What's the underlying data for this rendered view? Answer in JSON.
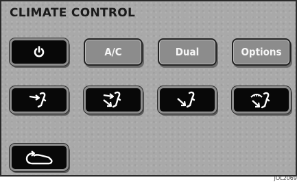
{
  "panel": {
    "title": "CLIMATE CONTROL"
  },
  "buttons_row1": {
    "power": {
      "icon": "power-icon"
    },
    "ac_label": "A/C",
    "dual_label": "Dual",
    "options_label": "Options"
  },
  "buttons_row2": [
    {
      "icon": "airflow-face-icon"
    },
    {
      "icon": "airflow-face-feet-icon"
    },
    {
      "icon": "airflow-feet-icon"
    },
    {
      "icon": "airflow-defrost-feet-icon"
    }
  ],
  "buttons_row3": {
    "recirculation": {
      "icon": "recirculation-icon"
    }
  },
  "footer": {
    "image_code": "JOL2069"
  },
  "colors": {
    "panel_background": "#a9a9a9",
    "active_button": "#080808",
    "inactive_button": "#8c8c8c"
  }
}
